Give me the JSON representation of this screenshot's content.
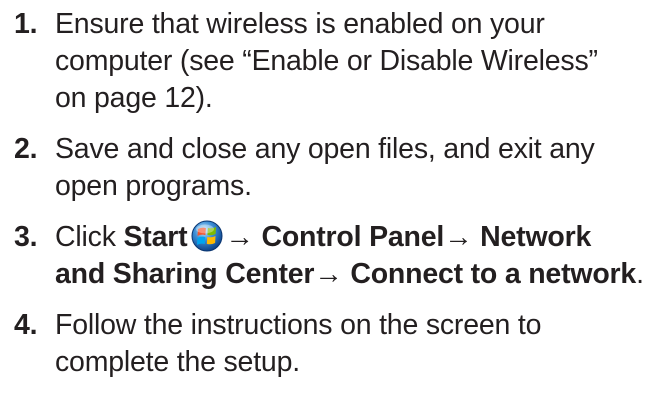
{
  "steps": [
    {
      "number": "1.",
      "lines": [
        "Ensure that wireless is enabled on your",
        "computer (see “Enable or Disable Wireless”",
        "on page 12)."
      ]
    },
    {
      "number": "2.",
      "lines": [
        "Save and close any open files, and exit any",
        "open programs."
      ]
    },
    {
      "number": "3.",
      "click_label": "Click",
      "start_label": "Start",
      "arrow": "→",
      "control_panel_label": "Control Panel",
      "network_label": "Network",
      "sharing_center_label": "and Sharing Center",
      "connect_label": "Connect to a network",
      "period": ".",
      "icon": "windows-start-orb-icon"
    },
    {
      "number": "4.",
      "lines": [
        "Follow the instructions on the screen to",
        "complete the setup."
      ]
    }
  ]
}
